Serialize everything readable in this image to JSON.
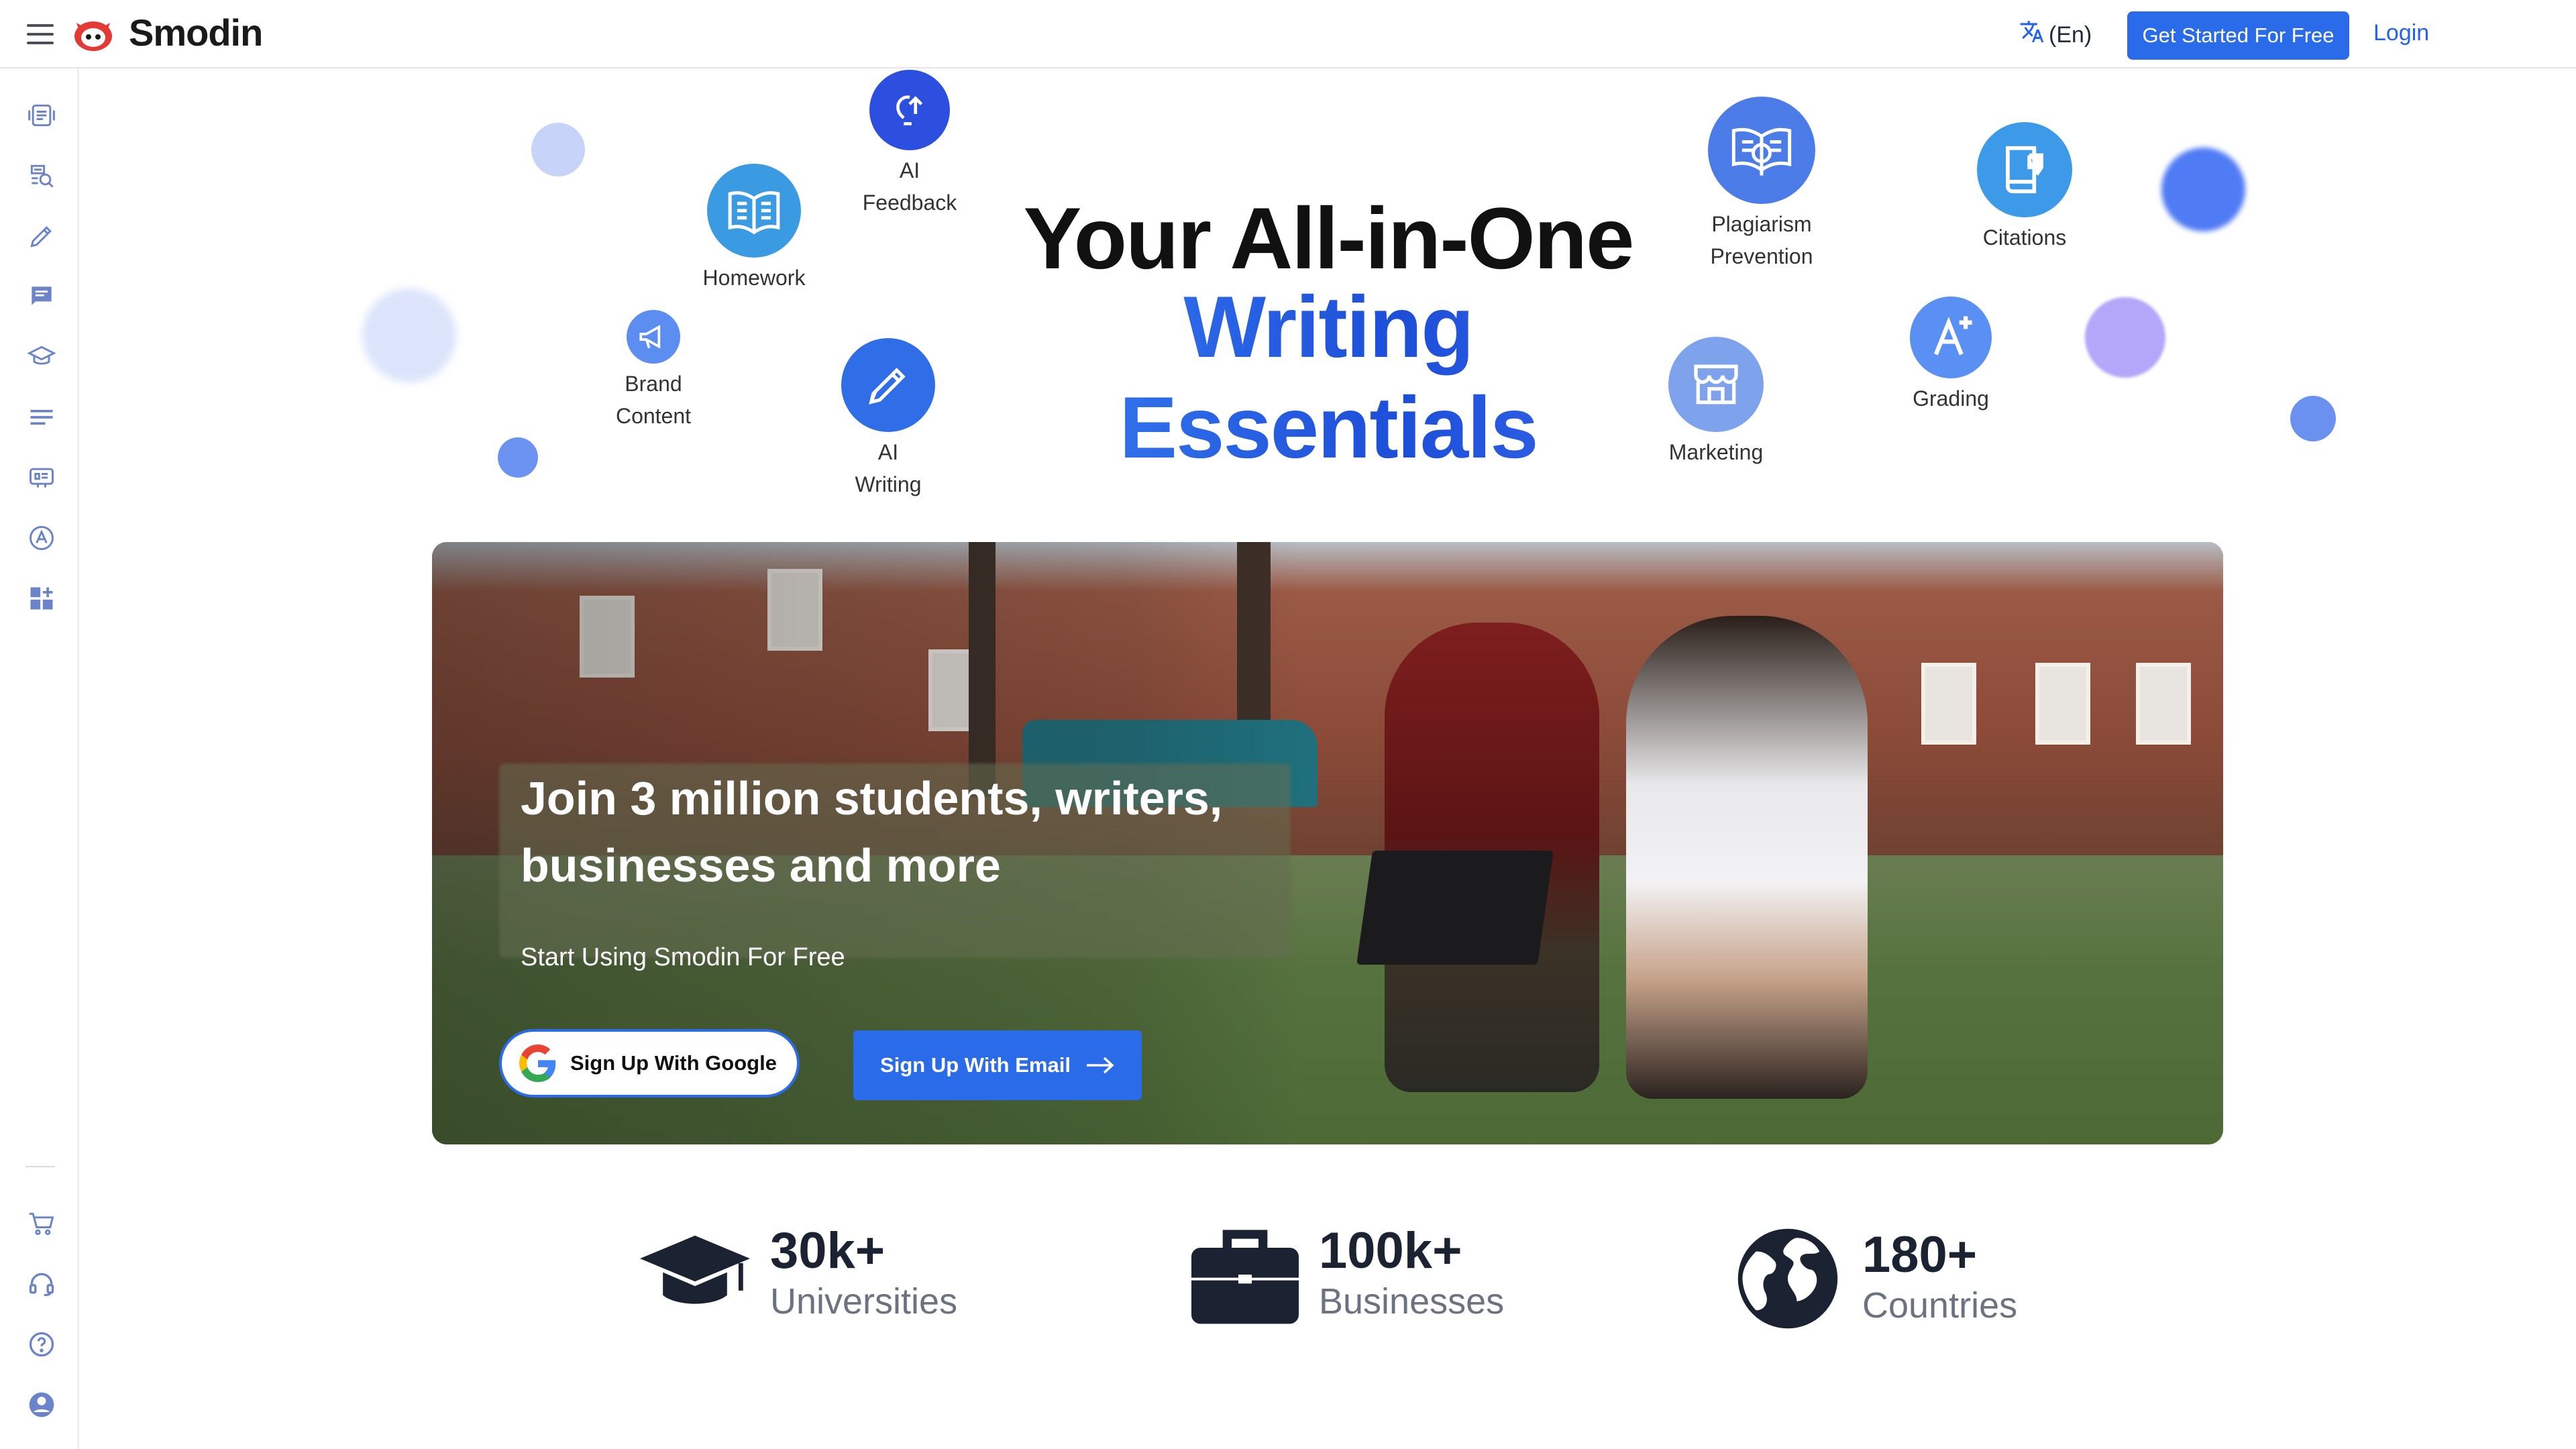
{
  "header": {
    "brand": "Smodin",
    "language": "(En)",
    "cta_label": "Get Started For Free",
    "login_label": "Login"
  },
  "sidebar": {
    "items": [
      "document-icon",
      "chat-search-icon",
      "pencil-icon",
      "message-icon",
      "graduation-icon",
      "lines-icon",
      "brain-icon",
      "grade-icon",
      "apps-icon"
    ],
    "bottom_items": [
      "cart-icon",
      "support-icon",
      "help-icon",
      "account-icon"
    ]
  },
  "hero": {
    "title_line1": "Your All-in-One",
    "title_line2": "Writing Essentials",
    "accent_gradient": [
      "#3b82f6",
      "#1d4ed8"
    ]
  },
  "features": [
    {
      "id": "ai-feedback",
      "label_1": "AI",
      "label_2": "Feedback",
      "color": "#2d4fe0"
    },
    {
      "id": "homework",
      "label_1": "Homework",
      "label_2": "",
      "color": "#3a9be3"
    },
    {
      "id": "brand-content",
      "label_1": "Brand",
      "label_2": "Content",
      "color": "#5b8ef0"
    },
    {
      "id": "ai-writing",
      "label_1": "AI",
      "label_2": "Writing",
      "color": "#2f6ee6"
    },
    {
      "id": "plagiarism-prevention",
      "label_1": "Plagiarism",
      "label_2": "Prevention",
      "color": "#4c7ce8"
    },
    {
      "id": "citations",
      "label_1": "Citations",
      "label_2": "",
      "color": "#3c9ae8"
    },
    {
      "id": "grading",
      "label_1": "Grading",
      "label_2": "",
      "color": "#5a8ff3"
    },
    {
      "id": "marketing",
      "label_1": "Marketing",
      "label_2": "",
      "color": "#7ea2ec"
    }
  ],
  "banner": {
    "headline": "Join 3 million students, writers, businesses and more",
    "subtext": "Start Using Smodin For Free",
    "google_button": "Sign Up With Google",
    "email_button": "Sign Up With Email"
  },
  "stats": [
    {
      "number": "30k+",
      "caption": "Universities",
      "icon": "graduation-cap-icon"
    },
    {
      "number": "100k+",
      "caption": "Businesses",
      "icon": "briefcase-icon"
    },
    {
      "number": "180+",
      "caption": "Countries",
      "icon": "globe-icon"
    }
  ]
}
